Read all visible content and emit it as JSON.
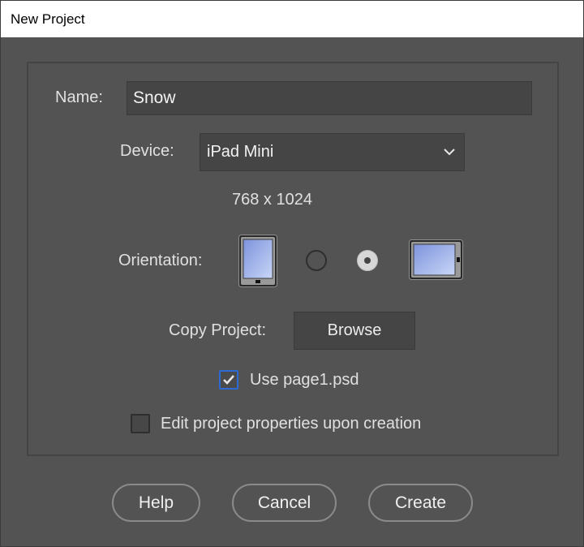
{
  "window": {
    "title": "New Project"
  },
  "form": {
    "name_label": "Name:",
    "name_value": "Snow",
    "device_label": "Device:",
    "device_value": "iPad Mini",
    "resolution": "768 x 1024",
    "orientation_label": "Orientation:",
    "orientation_selected": "landscape",
    "copy_project_label": "Copy Project:",
    "browse_label": "Browse",
    "use_page_label": "Use page1.psd",
    "use_page_checked": true,
    "edit_props_label": "Edit project properties upon creation",
    "edit_props_checked": false
  },
  "buttons": {
    "help": "Help",
    "cancel": "Cancel",
    "create": "Create"
  },
  "colors": {
    "background": "#535353",
    "input_bg": "#454545",
    "focus_blue": "#2c6bd1"
  }
}
